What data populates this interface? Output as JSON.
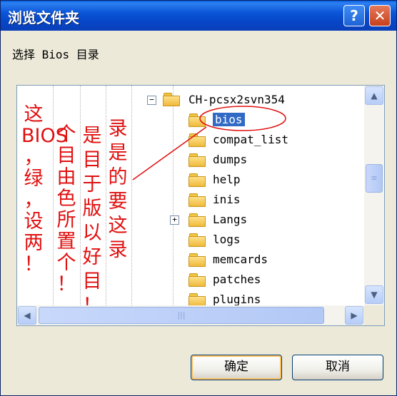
{
  "window": {
    "title": "浏览文件夹",
    "help_glyph": "?",
    "close_glyph": "✕"
  },
  "prompt": "选择 Bios 目录",
  "tree": {
    "root": {
      "label": "CH-pcsx2svn354",
      "expander": "−"
    },
    "items": [
      {
        "label": "bios",
        "selected": true
      },
      {
        "label": "compat_list"
      },
      {
        "label": "dumps"
      },
      {
        "label": "help"
      },
      {
        "label": "inis"
      },
      {
        "label": "Langs",
        "expander": "+"
      },
      {
        "label": "logs"
      },
      {
        "label": "memcards"
      },
      {
        "label": "patches"
      },
      {
        "label": "plugins"
      }
    ]
  },
  "annotation": {
    "columns": [
      [
        "这",
        "BIOS",
        "，",
        "绿",
        "，",
        "设",
        "两",
        "！"
      ],
      [
        "个",
        "目",
        "由",
        "色",
        "所",
        "置",
        "个",
        "！"
      ],
      [
        "是",
        "目",
        "于",
        "版",
        "以",
        "好",
        "目",
        "！"
      ],
      [
        "录",
        "是",
        "的",
        "要",
        "这",
        "录"
      ]
    ],
    "color": "#e01010"
  },
  "scrollbars": {
    "up": "▲",
    "down": "▼",
    "left": "◀",
    "right": "▶",
    "vgrip": "≡",
    "hgrip": "|||"
  },
  "buttons": {
    "ok": "确定",
    "cancel": "取消"
  },
  "colors": {
    "title_bar": "#0b55d8",
    "selection": "#316ac5",
    "annotation": "#e01010",
    "dialog_bg": "#ece9d8"
  }
}
